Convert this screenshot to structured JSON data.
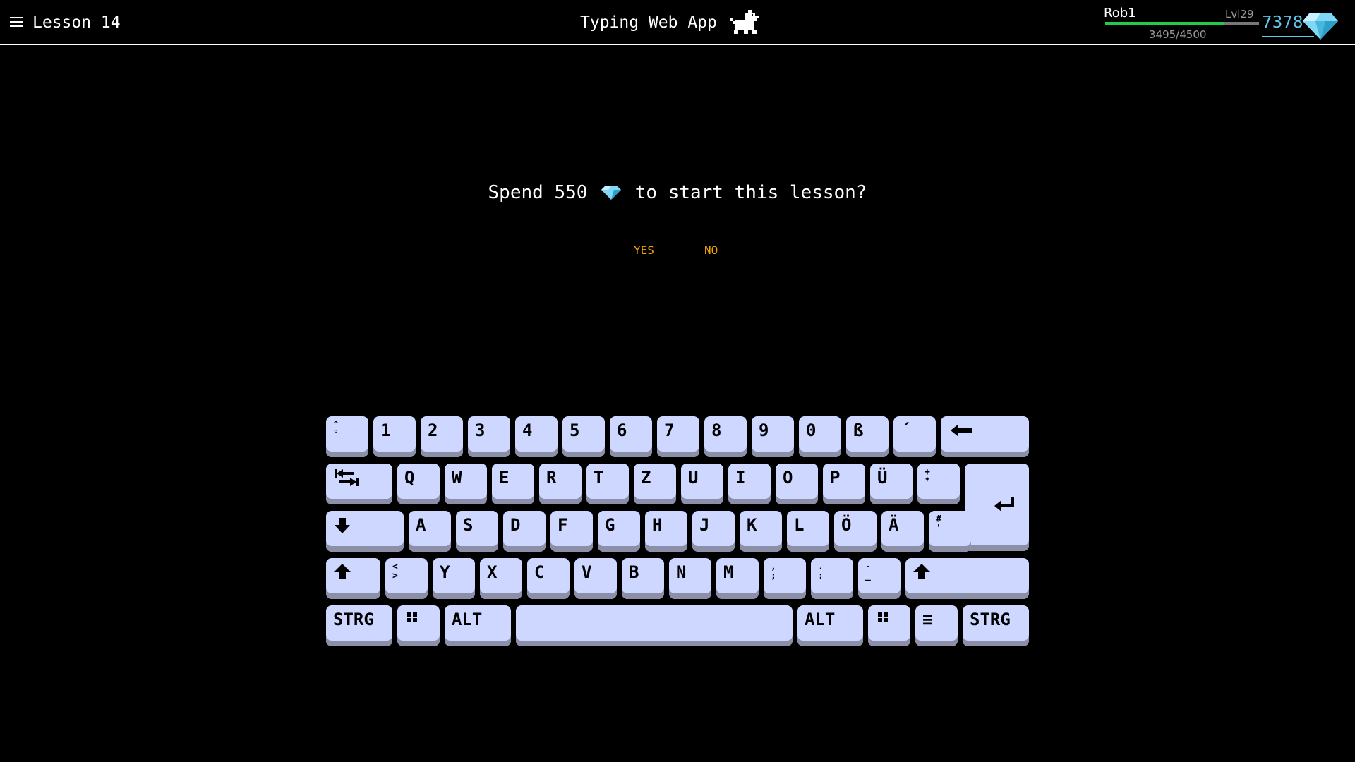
{
  "header": {
    "lesson_title": "Lesson 14",
    "app_title": "Typing Web App",
    "user_name": "Rob1",
    "level": "Lvl29",
    "xp_text": "3495/4500",
    "xp_fraction": 0.777,
    "gems": "7378"
  },
  "dialog": {
    "prompt_before": "Spend 550",
    "prompt_after": "to start this lesson?",
    "yes": "YES",
    "no": "NO"
  },
  "keyboard": {
    "row1": [
      "^\n°",
      "1",
      "2",
      "3",
      "4",
      "5",
      "6",
      "7",
      "8",
      "9",
      "0",
      "ß",
      "´"
    ],
    "row2": [
      "Q",
      "W",
      "E",
      "R",
      "T",
      "Z",
      "U",
      "I",
      "O",
      "P",
      "Ü",
      "+\n*"
    ],
    "row3": [
      "A",
      "S",
      "D",
      "F",
      "G",
      "H",
      "J",
      "K",
      "L",
      "Ö",
      "Ä",
      "#\n'"
    ],
    "row4": [
      "<\n>",
      "Y",
      "X",
      "C",
      "V",
      "B",
      "N",
      "M",
      ",\n;",
      ".\n:",
      "-\n_"
    ],
    "row5": [
      "STRG",
      "ALT",
      "ALT",
      "≡",
      "STRG"
    ]
  },
  "colors": {
    "key_face": "#cdd7ff",
    "key_shadow": "#8c8fa8",
    "gem": "#5ec8ea",
    "xp_bar": "#1fcc4c",
    "choice": "#f2a400"
  },
  "icons": [
    "menu-icon",
    "dog-icon",
    "diamond-icon",
    "backspace-icon",
    "tab-icon",
    "enter-icon",
    "caps-lock-icon",
    "shift-icon",
    "windows-icon"
  ]
}
